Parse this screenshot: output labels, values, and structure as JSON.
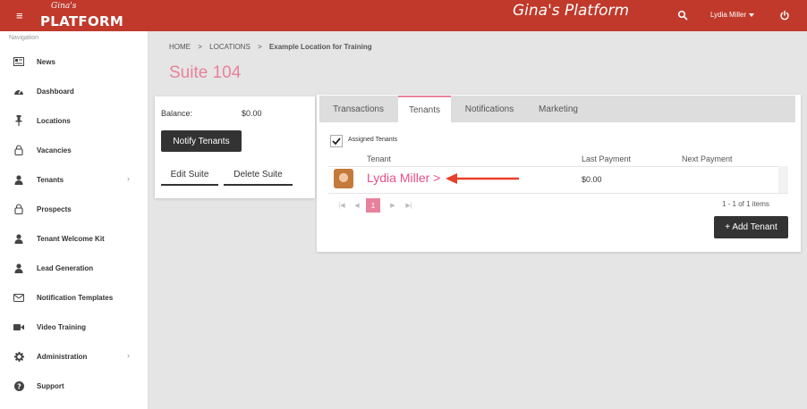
{
  "header": {
    "menu_icon": "hamburger-icon",
    "logo_script": "Gina's",
    "logo_main": "PLATFORM",
    "app_title": "Gina's Platform",
    "search_icon": "search-icon",
    "user_name": "Lydia Miller",
    "power_icon": "power-icon",
    "color": "#c0392b"
  },
  "sidebar": {
    "heading": "Navigation",
    "items": [
      {
        "label": "News",
        "icon": "newspaper-icon"
      },
      {
        "label": "Dashboard",
        "icon": "dashboard-icon"
      },
      {
        "label": "Locations",
        "icon": "pin-icon"
      },
      {
        "label": "Vacancies",
        "icon": "lock-icon"
      },
      {
        "label": "Tenants",
        "icon": "user-icon",
        "chevron": "›"
      },
      {
        "label": "Prospects",
        "icon": "lock-icon"
      },
      {
        "label": "Tenant Welcome Kit",
        "icon": "user-icon"
      },
      {
        "label": "Lead Generation",
        "icon": "user-icon"
      },
      {
        "label": "Notification Templates",
        "icon": "envelope-icon"
      },
      {
        "label": "Video Training",
        "icon": "video-icon"
      },
      {
        "label": "Administration",
        "icon": "gear-icon",
        "chevron": "›"
      },
      {
        "label": "Support",
        "icon": "question-icon"
      }
    ]
  },
  "breadcrumb": {
    "home": "HOME",
    "sep1": ">",
    "locations": "LOCATIONS",
    "sep2": ">",
    "current": "Example Location for Training"
  },
  "page_title": "Suite 104",
  "suite": {
    "balance_label": "Balance:",
    "balance_value": "$0.00",
    "notify_button": "Notify Tenants",
    "edit_button": "Edit Suite",
    "delete_button": "Delete Suite"
  },
  "tabs": [
    "Transactions",
    "Tenants",
    "Notifications",
    "Marketing"
  ],
  "active_tab": "Tenants",
  "tenants": {
    "assigned_label": "Assigned Tenants",
    "assigned_checked": true,
    "columns": [
      "Tenant",
      "Last Payment",
      "Next Payment"
    ],
    "rows": [
      {
        "name": "Lydia Miller >",
        "last_payment": "$0.00",
        "next_payment": ""
      }
    ],
    "pager": {
      "first": "|◀",
      "prev": "◀",
      "current": "1",
      "next": "▶",
      "last": "▶|"
    },
    "items_count": "1 - 1 of 1 items",
    "add_button": "+ Add Tenant"
  },
  "colors": {
    "accent": "#e8829c",
    "link": "#e84f8a",
    "annotation": "#e8402a"
  }
}
